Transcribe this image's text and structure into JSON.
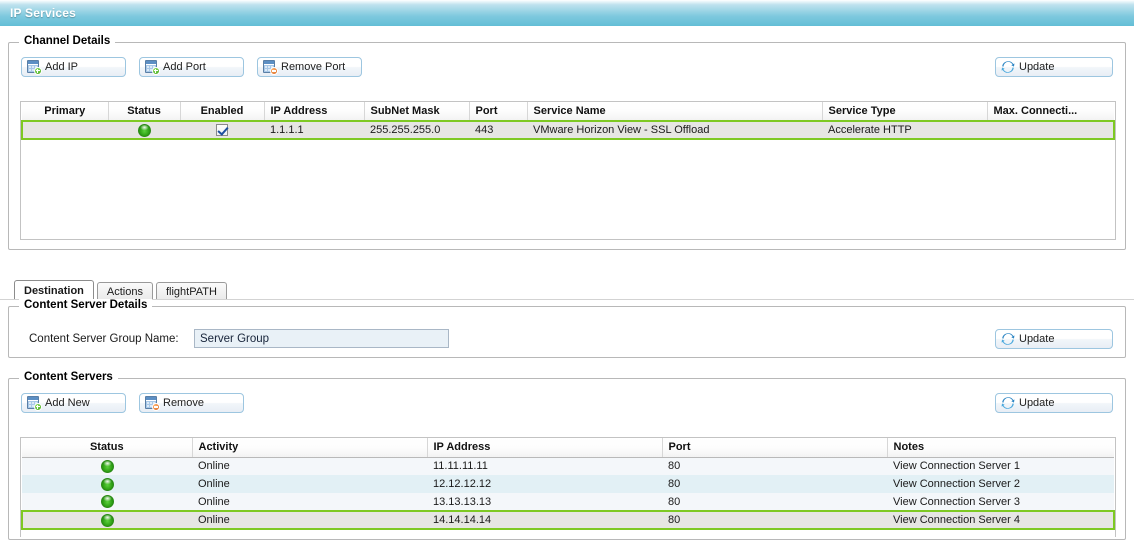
{
  "window": {
    "title": "IP Services"
  },
  "channel_details": {
    "legend": "Channel Details",
    "buttons": {
      "add_ip": "Add IP",
      "add_port": "Add Port",
      "remove_port": "Remove Port",
      "update": "Update"
    },
    "table": {
      "columns": [
        "Primary",
        "Status",
        "Enabled",
        "IP Address",
        "SubNet Mask",
        "Port",
        "Service Name",
        "Service Type",
        "Max. Connecti..."
      ],
      "rows": [
        {
          "primary": "",
          "status": "online",
          "enabled": true,
          "ip_address": "1.1.1.1",
          "subnet_mask": "255.255.255.0",
          "port": "443",
          "service_name": "VMware Horizon View - SSL Offload",
          "service_type": "Accelerate HTTP",
          "max_connections": "",
          "selected": true
        }
      ]
    }
  },
  "tabs": [
    {
      "label": "Destination",
      "active": true
    },
    {
      "label": "Actions",
      "active": false
    },
    {
      "label": "flightPATH",
      "active": false
    }
  ],
  "content_server_details": {
    "legend": "Content Server Details",
    "group_name_label": "Content Server Group Name:",
    "group_name_value": "Server Group",
    "group_name_placeholder": "",
    "update_label": "Update"
  },
  "content_servers": {
    "legend": "Content Servers",
    "buttons": {
      "add_new": "Add New",
      "remove": "Remove",
      "update": "Update"
    },
    "table": {
      "columns": [
        "Status",
        "Activity",
        "IP Address",
        "Port",
        "Notes"
      ],
      "rows": [
        {
          "status": "online",
          "activity": "Online",
          "ip_address": "11.11.11.11",
          "port": "80",
          "notes": "View Connection Server 1",
          "selected": false
        },
        {
          "status": "online",
          "activity": "Online",
          "ip_address": "12.12.12.12",
          "port": "80",
          "notes": "View Connection Server 2",
          "selected": false
        },
        {
          "status": "online",
          "activity": "Online",
          "ip_address": "13.13.13.13",
          "port": "80",
          "notes": "View Connection Server 3",
          "selected": false
        },
        {
          "status": "online",
          "activity": "Online",
          "ip_address": "14.14.14.14",
          "port": "80",
          "notes": "View Connection Server 4",
          "selected": true
        }
      ]
    }
  },
  "colors": {
    "title_bar": "#7ec9de",
    "selection_green": "#7ec923",
    "status_online": "#2fa015",
    "ip_text": "#2a2a7a",
    "input_bg": "#e9f1f7"
  },
  "icons": {
    "add_ip": "table-add-icon",
    "add_port": "table-add-icon",
    "remove_port": "table-remove-icon",
    "add_new": "table-add-icon",
    "remove": "table-remove-icon",
    "update": "refresh-icon",
    "status": "status-led-icon",
    "enabled": "checkbox-checked-icon"
  }
}
